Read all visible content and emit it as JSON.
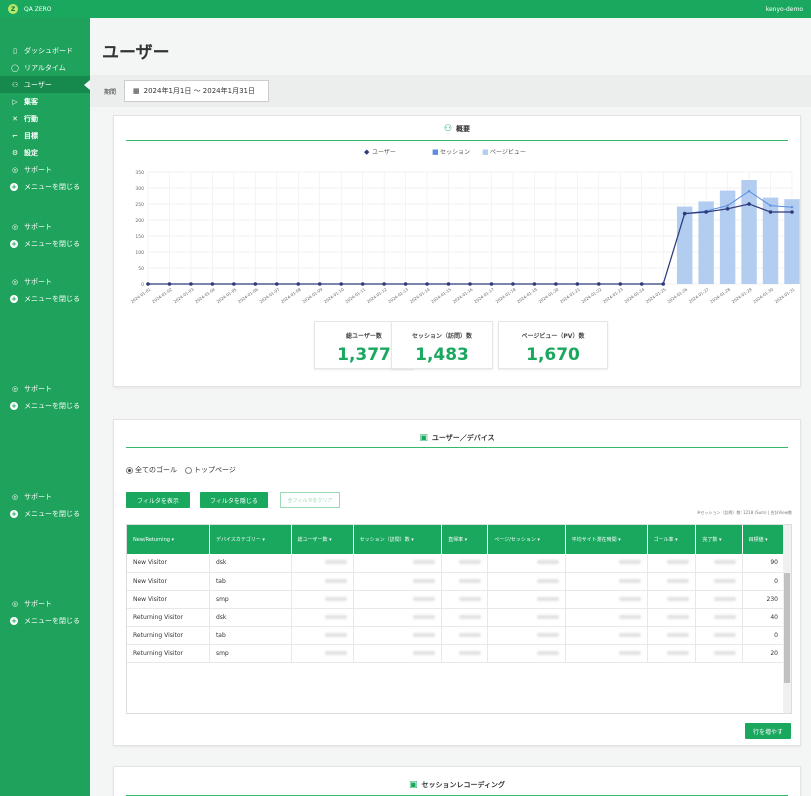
{
  "topbar": {
    "app_name": "QA ZERO",
    "logo_letter": "Z",
    "user": "kenyo-demo"
  },
  "sidebar": {
    "items": [
      {
        "icon": "▯",
        "label": "ダッシュボード",
        "top": 24
      },
      {
        "icon": "◯",
        "label": "リアルタイム",
        "top": 41
      },
      {
        "icon": "⚇",
        "label": "ユーザー",
        "top": 58,
        "active": true
      },
      {
        "icon": "▷",
        "label": "集客",
        "top": 75,
        "bold": true
      },
      {
        "icon": "✕",
        "label": "行動",
        "top": 92,
        "bold": true
      },
      {
        "icon": "⌐",
        "label": "目標",
        "top": 109,
        "bold": true
      },
      {
        "icon": "⚙",
        "label": "設定",
        "top": 126,
        "bold": true
      },
      {
        "icon": "◎",
        "label": "サポート",
        "top": 143
      },
      {
        "icon": "+",
        "label": "メニューを閉じる",
        "top": 160,
        "plus": true
      },
      {
        "icon": "◎",
        "label": "サポート",
        "top": 200
      },
      {
        "icon": "+",
        "label": "メニューを閉じる",
        "top": 217,
        "plus": true
      },
      {
        "icon": "◎",
        "label": "サポート",
        "top": 255
      },
      {
        "icon": "+",
        "label": "メニューを閉じる",
        "top": 272,
        "plus": true
      },
      {
        "icon": "◎",
        "label": "サポート",
        "top": 362
      },
      {
        "icon": "+",
        "label": "メニューを閉じる",
        "top": 379,
        "plus": true
      },
      {
        "icon": "◎",
        "label": "サポート",
        "top": 470
      },
      {
        "icon": "+",
        "label": "メニューを閉じる",
        "top": 487,
        "plus": true
      },
      {
        "icon": "◎",
        "label": "サポート",
        "top": 577
      },
      {
        "icon": "+",
        "label": "メニューを閉じる",
        "top": 594,
        "plus": true
      }
    ]
  },
  "page": {
    "title": "ユーザー",
    "period_label": "期間",
    "period_value": "2024年1月1日 ～ 2024年1月31日"
  },
  "overview": {
    "title": "概要",
    "legend": [
      "ユーザー",
      "セッション",
      "ページビュー"
    ],
    "stats": [
      {
        "label": "総ユーザー数",
        "value": "1,377"
      },
      {
        "label": "セッション（訪問）数",
        "value": "1,483"
      },
      {
        "label": "ページビュー（PV）数",
        "value": "1,670"
      }
    ]
  },
  "chart_data": {
    "type": "bar",
    "x": [
      "2024-01-01",
      "2024-01-02",
      "2024-01-03",
      "2024-01-04",
      "2024-01-05",
      "2024-01-06",
      "2024-01-07",
      "2024-01-08",
      "2024-01-09",
      "2024-01-10",
      "2024-01-11",
      "2024-01-12",
      "2024-01-13",
      "2024-01-14",
      "2024-01-15",
      "2024-01-16",
      "2024-01-17",
      "2024-01-18",
      "2024-01-19",
      "2024-01-20",
      "2024-01-21",
      "2024-01-22",
      "2024-01-23",
      "2024-01-24",
      "2024-01-25",
      "2024-01-26",
      "2024-01-27",
      "2024-01-28",
      "2024-01-29",
      "2024-01-30",
      "2024-01-31"
    ],
    "series": [
      {
        "name": "ユーザー",
        "kind": "line",
        "color": "#2e3a7a",
        "values": [
          0,
          0,
          0,
          0,
          0,
          0,
          0,
          0,
          0,
          0,
          0,
          0,
          0,
          0,
          0,
          0,
          0,
          0,
          0,
          0,
          0,
          0,
          0,
          0,
          0,
          220,
          225,
          235,
          250,
          225,
          225
        ]
      },
      {
        "name": "セッション",
        "kind": "line",
        "color": "#5b8de0",
        "values": [
          0,
          0,
          0,
          0,
          0,
          0,
          0,
          0,
          0,
          0,
          0,
          0,
          0,
          0,
          0,
          0,
          0,
          0,
          0,
          0,
          0,
          0,
          0,
          0,
          0,
          220,
          228,
          245,
          290,
          245,
          240
        ]
      },
      {
        "name": "ページビュー",
        "kind": "bar",
        "color": "#b3cdf1",
        "values": [
          0,
          0,
          0,
          0,
          0,
          0,
          0,
          0,
          0,
          0,
          0,
          0,
          0,
          0,
          0,
          0,
          0,
          0,
          0,
          0,
          0,
          0,
          0,
          0,
          0,
          242,
          258,
          292,
          325,
          270,
          265
        ]
      }
    ],
    "yticks": [
      0,
      50,
      100,
      150,
      200,
      250,
      300,
      350
    ],
    "ylim": [
      0,
      350
    ],
    "grid": true,
    "legend": "top-center"
  },
  "devices": {
    "title": "ユーザー／デバイス",
    "radios": [
      {
        "label": "全てのゴール",
        "checked": true
      },
      {
        "label": "トップページ",
        "checked": false
      }
    ],
    "btn_show_filter": "フィルタを表示",
    "btn_hide_filter": "フィルタを隠じる",
    "btn_clear": "全フィルタをクリア",
    "note": "※セッション（訪問）数: 1218 (Sum) | 合計View数",
    "columns": [
      "New/Returning ▾",
      "デバイスカテゴリー ▾",
      "総ユーザー数 ▾",
      "セッション（訪問）数 ▾",
      "直帰率 ▾",
      "ページ/セッション ▾",
      "平均サイト滞在時間 ▾",
      "ゴール率 ▾",
      "完了数 ▾",
      "目標値 ▾"
    ],
    "rows": [
      {
        "nr": "New Visitor",
        "dev": "dsk",
        "goal": "90"
      },
      {
        "nr": "New Visitor",
        "dev": "tab",
        "goal": "0"
      },
      {
        "nr": "New Visitor",
        "dev": "smp",
        "goal": "230"
      },
      {
        "nr": "Returning Visitor",
        "dev": "dsk",
        "goal": "40"
      },
      {
        "nr": "Returning Visitor",
        "dev": "tab",
        "goal": "0"
      },
      {
        "nr": "Returning Visitor",
        "dev": "smp",
        "goal": "20"
      }
    ],
    "more_rows": "行を増やす"
  },
  "recording": {
    "title": "セッションレコーディング"
  }
}
